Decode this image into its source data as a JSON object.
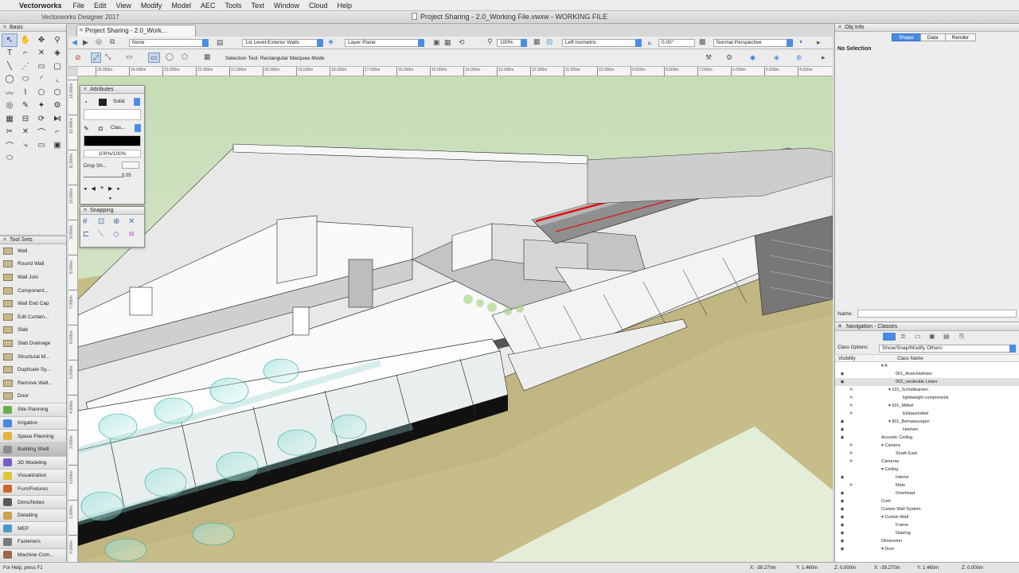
{
  "menubar": {
    "app_name": "Vectorworks",
    "items": [
      "File",
      "Edit",
      "View",
      "Modify",
      "Model",
      "AEC",
      "Tools",
      "Text",
      "Window",
      "Cloud",
      "Help"
    ]
  },
  "window": {
    "app_title": "Vectorworks Designer 2017",
    "doc_title": "Project Sharing - 2.0_Working File.vwxw - WORKING FILE",
    "tab_label": "Project Sharing - 2.0_Work..."
  },
  "view_bar": {
    "class_value": "None",
    "layer_value": "1st Level-Exterior Walls",
    "plane_value": "Layer Plane",
    "zoom_value": "100%",
    "view_value": "Left Isometric",
    "rotation_value": "0.00°",
    "render_value": "Normal Perspective"
  },
  "mode_bar": {
    "label": "Selection Tool: Rectangular Marquee Mode"
  },
  "rulers": {
    "h_ticks": [
      "25.000m",
      "24.000m",
      "23.000m",
      "22.000m",
      "21.000m",
      "20.000m",
      "19.000m",
      "18.000m",
      "17.000m",
      "16.000m",
      "15.000m",
      "14.000m",
      "13.000m",
      "12.000m",
      "11.000m",
      "10.000m",
      "9.000m",
      "8.000m",
      "7.000m",
      "6.000m",
      "5.000m",
      "4.000m"
    ],
    "v_ticks": [
      "13.000m",
      "12.000m",
      "11.000m",
      "10.000m",
      "9.000m",
      "8.000m",
      "7.000m",
      "6.000m",
      "5.000m",
      "4.000m",
      "3.000m",
      "2.000m",
      "1.000m",
      "0.000m"
    ]
  },
  "basic_palette": {
    "title": "Basic"
  },
  "attributes": {
    "title": "Attributes",
    "fill_style": "Solid",
    "pen_style": "Clas...",
    "opacity": "100%/100%",
    "drop_shadow": "Drop Sh...",
    "line_weight": "0.05"
  },
  "snapping": {
    "title": "Snapping"
  },
  "tool_sets": {
    "title": "Tool Sets",
    "tools": [
      "Wall",
      "Round Wall",
      "Wall Join",
      "Component...",
      "Wall End Cap",
      "Edit Curtain...",
      "Slab",
      "Slab Drainage",
      "Structural M...",
      "Duplicate Sy...",
      "Remove Wall...",
      "Door"
    ],
    "categories": [
      {
        "label": "Site Planning",
        "color": "#6bb04a"
      },
      {
        "label": "Irrigation",
        "color": "#4a8ae0"
      },
      {
        "label": "Space Planning",
        "color": "#e3b23c"
      },
      {
        "label": "Building Shell",
        "color": "#8c8c8c"
      },
      {
        "label": "3D Modeling",
        "color": "#7a5cc9"
      },
      {
        "label": "Visualization",
        "color": "#e0c43a"
      },
      {
        "label": "Furn/Fixtures",
        "color": "#c96a2b"
      },
      {
        "label": "Dims/Notes",
        "color": "#5a5a5a"
      },
      {
        "label": "Detailing",
        "color": "#c9a24a"
      },
      {
        "label": "MEP",
        "color": "#4a9ac9"
      },
      {
        "label": "Fasteners",
        "color": "#7a7a7a"
      },
      {
        "label": "Machine Com...",
        "color": "#9a6a4a"
      }
    ]
  },
  "obj_info": {
    "title": "Obj Info",
    "tabs": [
      "Shape",
      "Data",
      "Render"
    ],
    "selection": "No Selection",
    "name_label": "Name:"
  },
  "nav_classes": {
    "title": "Navigation - Classes",
    "options_label": "Class Options:",
    "options_value": "Show/Snap/Modify Others",
    "col_visibility": "Visibility",
    "col_name": "Class Name",
    "rows": [
      {
        "name": "A",
        "indent": 0,
        "expanded": true,
        "vis": ""
      },
      {
        "name": "001_Ansichtslinien",
        "indent": 2,
        "vis": "eye"
      },
      {
        "name": "002_verdeckte Linien",
        "indent": 2,
        "vis": "eye",
        "selected": true
      },
      {
        "name": "101_Schnittkanten",
        "indent": 1,
        "expanded": true,
        "vis": "x"
      },
      {
        "name": "lightweight components",
        "indent": 3,
        "vis": "x"
      },
      {
        "name": "601_Möbel",
        "indent": 1,
        "expanded": true,
        "vis": "x"
      },
      {
        "name": "Einbaumöbel",
        "indent": 3,
        "vis": "x"
      },
      {
        "name": "801_Bemassungen",
        "indent": 1,
        "expanded": true,
        "vis": "eye"
      },
      {
        "name": "Hoehen",
        "indent": 3,
        "vis": "eye"
      },
      {
        "name": "Acoustic Ceiling",
        "indent": 0,
        "vis": "eye"
      },
      {
        "name": "Camera",
        "indent": 0,
        "expanded": true,
        "vis": "x"
      },
      {
        "name": "South East",
        "indent": 2,
        "vis": "x"
      },
      {
        "name": "Cameras",
        "indent": 0,
        "vis": "x"
      },
      {
        "name": "Ceiling",
        "indent": 0,
        "expanded": true,
        "vis": ""
      },
      {
        "name": "Interior",
        "indent": 2,
        "vis": "eye"
      },
      {
        "name": "Main",
        "indent": 2,
        "vis": "x"
      },
      {
        "name": "Overhead",
        "indent": 2,
        "vis": "eye"
      },
      {
        "name": "Curb",
        "indent": 0,
        "vis": "eye"
      },
      {
        "name": "Curtain Wall System",
        "indent": 0,
        "vis": "eye"
      },
      {
        "name": "Curtain Wall",
        "indent": 0,
        "expanded": true,
        "vis": "eye"
      },
      {
        "name": "Frame",
        "indent": 2,
        "vis": "eye"
      },
      {
        "name": "Glazing",
        "indent": 2,
        "vis": "eye"
      },
      {
        "name": "Dimension",
        "indent": 0,
        "vis": "eye"
      },
      {
        "name": "Door",
        "indent": 0,
        "expanded": true,
        "vis": "eye"
      }
    ]
  },
  "status": {
    "help": "For Help, press F1",
    "x1": "X: -39.270m",
    "y1": "Y: 1.460m",
    "z": "Z: 0.000m",
    "x2": "X: -39.270m",
    "y2": "Y: 1.460m",
    "z2": "Z: 0.000m"
  }
}
